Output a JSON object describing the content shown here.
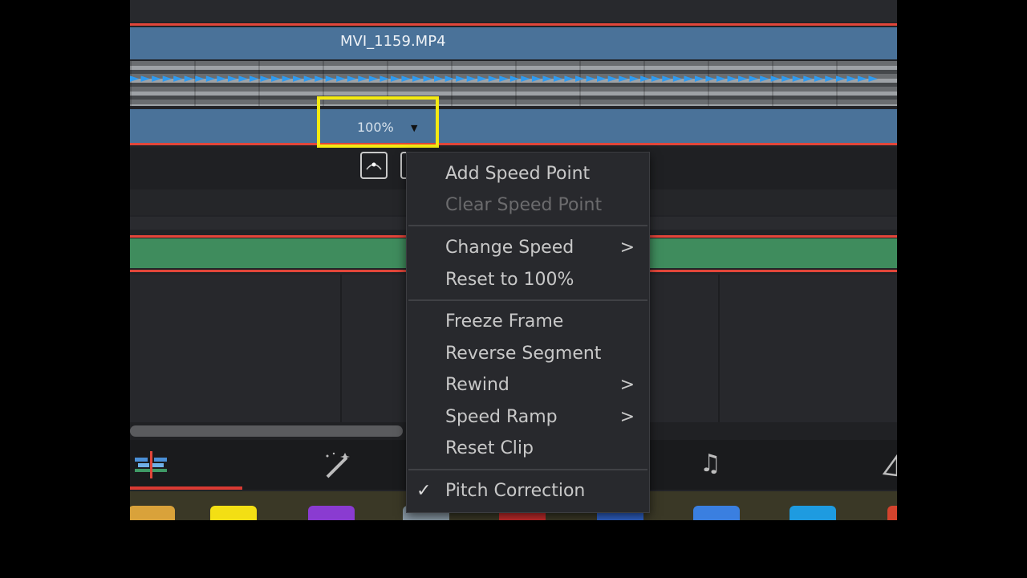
{
  "timeline": {
    "clip_name": "MVI_1159.MP4",
    "speed_value": "100%",
    "speed_caret": "▼",
    "arrow_glyphs": "►►►►►►►►►►►►►►►►►►►►►►►►►►►►►►►►►►►►►►►►►►►►►►►►►►►►►►►►►►►►►►►►►►►►►",
    "highlight_color": "#f4ea12",
    "clip_color": "#4a7299",
    "audio_color": "#3f8c5d",
    "accent_red": "#e2463a"
  },
  "context_menu": {
    "add_speed_point": "Add Speed Point",
    "clear_speed_point": "Clear Speed Point",
    "change_speed": "Change Speed",
    "reset_to_100": "Reset to 100%",
    "freeze_frame": "Freeze Frame",
    "reverse_segment": "Reverse Segment",
    "rewind": "Rewind",
    "speed_ramp": "Speed Ramp",
    "reset_clip": "Reset Clip",
    "pitch_correction": "Pitch Correction",
    "pitch_correction_checked": true,
    "submenu_chevron": ">",
    "check_mark": "✓"
  },
  "page_tabs": [
    {
      "icon": "edit-timeline-icon",
      "active": true
    },
    {
      "icon": "fusion-wand-icon",
      "active": false
    },
    {
      "icon": "fairlight-music-icon",
      "active": false
    },
    {
      "icon": "deliver-rocket-icon",
      "active": false
    }
  ],
  "dock_icons": [
    "folder-icon",
    "app-icon-yellow",
    "app-icon-purple",
    "app-icon-gray",
    "app-icon-red",
    "app-icon-blue",
    "app-icon-blue2",
    "app-icon-cyan",
    "app-icon-orange"
  ]
}
